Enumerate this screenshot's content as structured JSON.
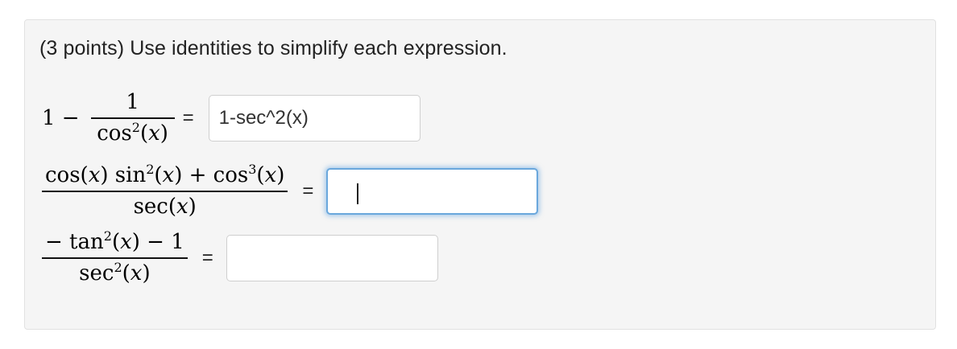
{
  "problem": {
    "prompt": "(3 points) Use identities to simplify each expression."
  },
  "expressions": [
    {
      "lead": "1 −",
      "numerator": "1",
      "denominator_html": "cos<sup>2</sup>(<i>x</i>)",
      "equals": "=",
      "answer_value": "1-sec^2(x)"
    },
    {
      "lead": "",
      "numerator_html": "cos(<i>x</i>) sin<sup>2</sup>(<i>x</i>) + cos<sup>3</sup>(<i>x</i>)",
      "denominator_html": "sec(<i>x</i>)",
      "equals": "=",
      "answer_value": ""
    },
    {
      "lead": "",
      "numerator_html": "− tan<sup>2</sup>(<i>x</i>) − 1",
      "denominator_html": "sec<sup>2</sup>(<i>x</i>)",
      "equals": "=",
      "answer_value": ""
    }
  ]
}
